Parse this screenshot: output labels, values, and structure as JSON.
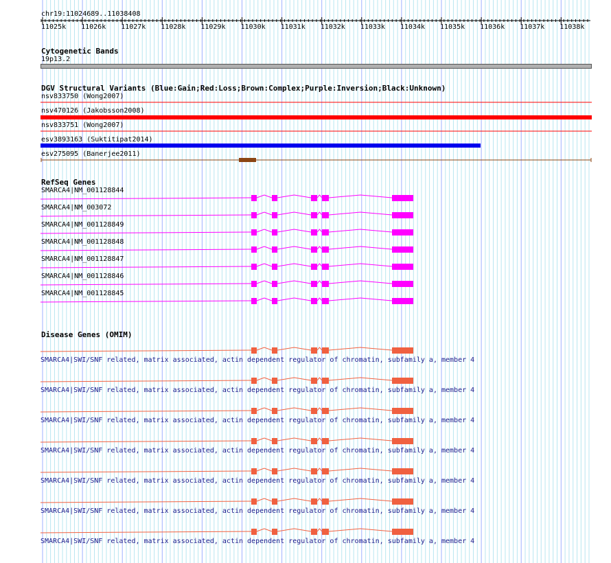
{
  "location": "chr19:11024689..11038408",
  "ruler": {
    "ticks": [
      "11025k",
      "11026k",
      "11027k",
      "11028k",
      "11029k",
      "11030k",
      "11031k",
      "11032k",
      "11033k",
      "11034k",
      "11035k",
      "11036k",
      "11037k",
      "11038k"
    ]
  },
  "cytoband": {
    "title": "Cytogenetic Bands",
    "label": "19p13.2",
    "color": "#999999"
  },
  "dgv": {
    "title": "DGV Structural Variants (Blue:Gain;Red:Loss;Brown:Complex;Purple:Inversion;Black:Unknown)",
    "colors": {
      "gain": "#0000ee",
      "loss": "#ff0000",
      "complex": "#8b4513"
    },
    "items": [
      {
        "label": "nsv833750 (Wong2007)",
        "type": "loss",
        "style": "thin"
      },
      {
        "label": "nsv470126 (Jakobsson2008)",
        "type": "loss",
        "style": "thick"
      },
      {
        "label": "nsv833751 (Wong2007)",
        "type": "loss",
        "style": "thin"
      },
      {
        "label": "esv3893163 (Suktitipat2014)",
        "type": "gain",
        "style": "thick"
      },
      {
        "label": "esv275095 (Banerjee2011)",
        "type": "complex",
        "style": "block"
      }
    ]
  },
  "refseq": {
    "title": "RefSeq Genes",
    "color": "#ff00ff",
    "transcripts": [
      "SMARCA4|NM_001128844",
      "SMARCA4|NM_003072",
      "SMARCA4|NM_001128849",
      "SMARCA4|NM_001128848",
      "SMARCA4|NM_001128847",
      "SMARCA4|NM_001128846",
      "SMARCA4|NM_001128845"
    ]
  },
  "omim": {
    "title": "Disease Genes (OMIM)",
    "color": "#f06040",
    "entries": [
      "SMARCA4|SWI/SNF related, matrix associated, actin dependent regulator of chromatin, subfamily a, member 4",
      "SMARCA4|SWI/SNF related, matrix associated, actin dependent regulator of chromatin, subfamily a, member 4",
      "SMARCA4|SWI/SNF related, matrix associated, actin dependent regulator of chromatin, subfamily a, member 4",
      "SMARCA4|SWI/SNF related, matrix associated, actin dependent regulator of chromatin, subfamily a, member 4",
      "SMARCA4|SWI/SNF related, matrix associated, actin dependent regulator of chromatin, subfamily a, member 4",
      "SMARCA4|SWI/SNF related, matrix associated, actin dependent regulator of chromatin, subfamily a, member 4",
      "SMARCA4|SWI/SNF related, matrix associated, actin dependent regulator of chromatin, subfamily a, member 4"
    ]
  }
}
